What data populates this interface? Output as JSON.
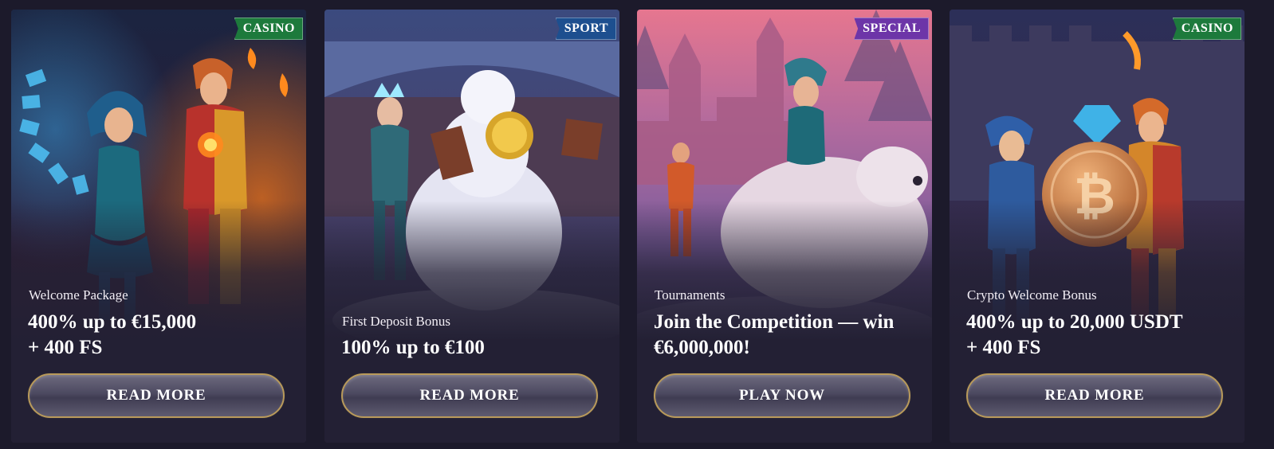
{
  "promotions": [
    {
      "tag": "CASINO",
      "subtitle": "Welcome Package",
      "headline_line1": "400% up to €15,000",
      "headline_line2": "+ 400 FS",
      "button_label": "READ MORE"
    },
    {
      "tag": "SPORT",
      "subtitle": "First Deposit Bonus",
      "headline_line1": "100% up to €100",
      "headline_line2": "",
      "button_label": "READ MORE"
    },
    {
      "tag": "SPECIAL",
      "subtitle": "Tournaments",
      "headline_line1": "Join the Competition — win",
      "headline_line2": "€6,000,000!",
      "button_label": "PLAY NOW"
    },
    {
      "tag": "CASINO",
      "subtitle": "Crypto Welcome Bonus",
      "headline_line1": "400% up to 20,000 USDT",
      "headline_line2": "+ 400 FS",
      "button_label": "READ MORE"
    }
  ],
  "colors": {
    "page_background": "#1c1a2b",
    "card_background": "#232034",
    "tag_casino": "#1d7a3c",
    "tag_sport": "#1d4f8f",
    "tag_special": "#6d35a8",
    "button_border_gold": "#b99a5a"
  }
}
